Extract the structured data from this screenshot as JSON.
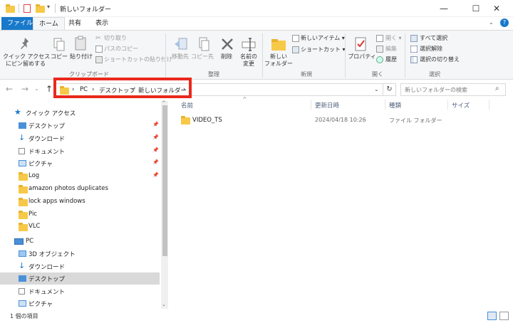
{
  "titlebar": {
    "title": "新しいフォルダー",
    "minimize": "—",
    "maximize": "☐",
    "close": "✕"
  },
  "ribbon_tabs": [
    "ファイル",
    "ホーム",
    "共有",
    "表示"
  ],
  "help_icon": "?",
  "ribbon": {
    "clipboard": {
      "pin": "クイック アクセス\nにピン留めする",
      "copy": "コピー",
      "paste": "貼り付け",
      "cut": "切り取り",
      "copy_path": "パスのコピー",
      "paste_shortcut": "ショートカットの貼り付け",
      "group": "クリップボード"
    },
    "organize": {
      "move_to": "移動先",
      "copy_to": "コピー先",
      "delete": "削除",
      "rename": "名前の\n変更",
      "group": "整理"
    },
    "new": {
      "new_folder": "新しい\nフォルダー",
      "new_item": "新しいアイテム ▾",
      "shortcut": "ショートカット ▾",
      "group": "新規"
    },
    "open": {
      "properties": "プロパティ",
      "open": "開く ▾",
      "edit": "編集",
      "history": "履歴",
      "group": "開く"
    },
    "select": {
      "select_all": "すべて選択",
      "select_none": "選択解除",
      "invert": "選択の切り替え",
      "group": "選択"
    }
  },
  "address": {
    "crumbs": [
      "PC",
      "デスクトップ",
      "新しいフォルダー"
    ],
    "separator": "›",
    "search_placeholder": "新しいフォルダーの検索"
  },
  "nav": {
    "quick_access": "クイック アクセス",
    "items": [
      {
        "label": "デスクトップ",
        "pinned": true
      },
      {
        "label": "ダウンロード",
        "pinned": true
      },
      {
        "label": "ドキュメント",
        "pinned": true
      },
      {
        "label": "ピクチャ",
        "pinned": true
      },
      {
        "label": "Log",
        "pinned": true
      },
      {
        "label": "amazon photos duplicates",
        "pinned": false
      },
      {
        "label": "lock apps windows",
        "pinned": false
      },
      {
        "label": "Pic",
        "pinned": false
      },
      {
        "label": "VLC",
        "pinned": false
      }
    ],
    "pc": "PC",
    "pc_items": [
      "3D オブジェクト",
      "ダウンロード",
      "デスクトップ",
      "ドキュメント",
      "ピクチャ"
    ]
  },
  "columns": [
    "名前",
    "更新日時",
    "種類",
    "サイズ"
  ],
  "files": [
    {
      "name": "VIDEO_TS",
      "modified": "2024/04/18 10:26",
      "type": "ファイル フォルダー",
      "size": ""
    }
  ],
  "status": {
    "count": "1 個の項目"
  }
}
